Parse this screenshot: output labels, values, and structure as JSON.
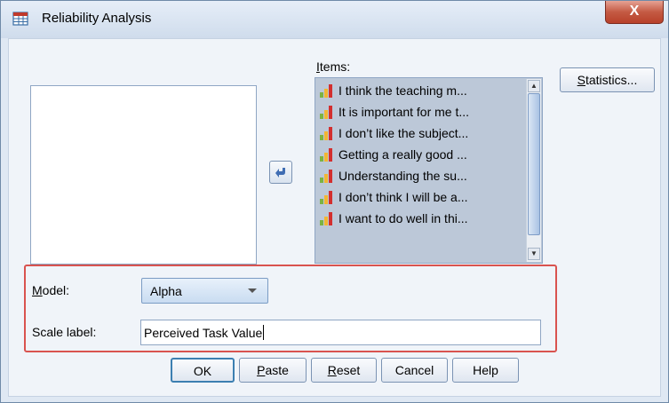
{
  "window": {
    "title": "Reliability Analysis",
    "close_glyph": "X"
  },
  "items_panel": {
    "label_prefix": "I",
    "label_rest": "tems:",
    "items": [
      "I think the teaching m...",
      "It is important for me t...",
      "I don’t like the subject...",
      "Getting a really good ...",
      "Understanding the su...",
      "I don’t think I will be a...",
      "I want to do well in thi..."
    ],
    "item_icon": "scale-variable-icon"
  },
  "statistics_button": {
    "mnemonic": "S",
    "rest": "tatistics..."
  },
  "model": {
    "label_prefix": "M",
    "label_rest": "odel:",
    "selected": "Alpha"
  },
  "scale_label": {
    "label": "Scale label:",
    "value": "Perceived Task Value"
  },
  "buttons": {
    "ok": "OK",
    "paste_mnemonic": "P",
    "paste_rest": "aste",
    "reset_mnemonic": "R",
    "reset_rest": "eset",
    "cancel": "Cancel",
    "help": "Help"
  },
  "colors": {
    "highlight_border": "#d9534f",
    "title_bar": "#dfe8f3",
    "close_button": "#c45a43"
  }
}
